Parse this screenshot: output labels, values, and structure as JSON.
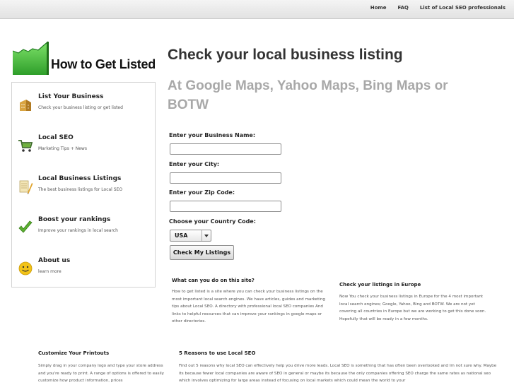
{
  "topnav": {
    "home": "Home",
    "faq": "FAQ",
    "list": "List of Local SEO professionals"
  },
  "logo": {
    "text": "How to Get Listed"
  },
  "sidebar": {
    "items": [
      {
        "title": "List Your Business",
        "desc": "Check your business listing or get listed",
        "icon": "buildings-icon"
      },
      {
        "title": "Local SEO",
        "desc": "Marketing Tips + News",
        "icon": "shopping-cart-icon"
      },
      {
        "title": "Local Business Listings",
        "desc": "The best business listings for Local SEO",
        "icon": "pencil-ruler-icon"
      },
      {
        "title": "Boost your rankings",
        "desc": "Improve your rankings in local search",
        "icon": "checkmark-icon"
      },
      {
        "title": "About us",
        "desc": "learn more",
        "icon": "smiley-icon"
      }
    ]
  },
  "main": {
    "title": "Check your local business listing",
    "subtitle": "At Google Maps, Yahoo Maps, Bing Maps or BOTW"
  },
  "form": {
    "business_label": "Enter your Business Name:",
    "business_value": "",
    "city_label": "Enter your City:",
    "city_value": "",
    "zip_label": "Enter your Zip Code:",
    "zip_value": "",
    "country_label": "Choose your Country Code:",
    "country_value": "USA",
    "submit_label": "Check My Listings"
  },
  "info": {
    "what_title": "What can you do on this site?",
    "what_text": "How to get listed is a site where you can check your business listings on the most important local search engines. We have articles, guides and marketing tips about Local SEO. A directory with professional local SEO companies And links to helpful resources that can improve your rankings in google maps or other directories.",
    "europe_title": "Check your listings in Europe",
    "europe_text": "Now You check your business listings in Europe for the 4 most important local search engines; Google, Yahoo, Bing and BOTW. We are not yet covering all countries in Europe but we are working to get this done soon. Hopefully that will be ready in a few months.",
    "printouts_title": "Customize Your Printouts",
    "printouts_text": "Simply drag in your company logo and type your store address and you're ready to print. A range of options is offered to easily customize how product information, prices",
    "reasons_title": "5 Reasons to use Local SEO",
    "reasons_text": "Find out 5 reasons why local SEO can effectively help you drive more leads. Local SEO is something that has often been overlooked and Im not sure why. Maybe its because fewer local companies are aware of SEO in general or maybe its because the only companies offering SEO charge the same rates as national seo which involves optimizing for large areas instead of focusing on local markets which could mean the world to your"
  }
}
